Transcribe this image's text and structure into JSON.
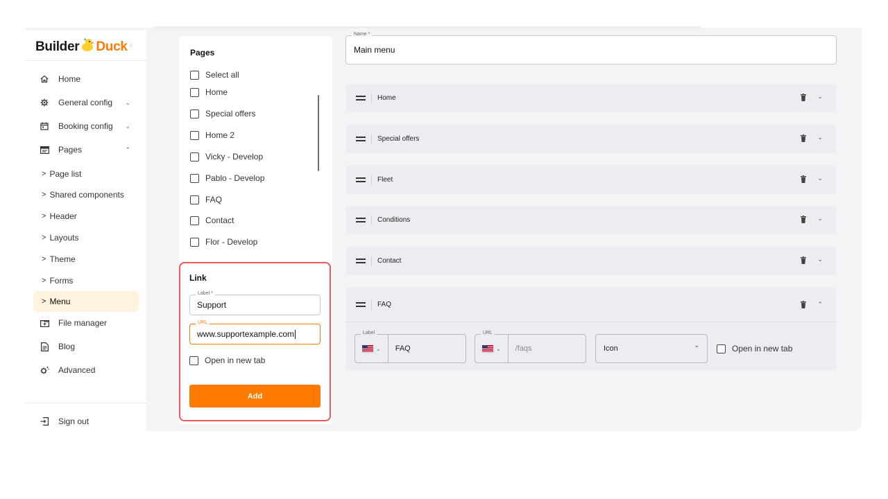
{
  "sidebar": {
    "logo_left": "Builder",
    "logo_right": "Duck",
    "collapse_glyph": "‹",
    "nav": [
      {
        "label": "Home",
        "icon": "home-icon"
      },
      {
        "label": "General config",
        "icon": "gear-icon",
        "chevron": "⌄"
      },
      {
        "label": "Booking config",
        "icon": "calendar-icon",
        "chevron": "⌄"
      },
      {
        "label": "Pages",
        "icon": "browser-icon",
        "chevron": "⌃"
      }
    ],
    "sub": [
      {
        "label": "Page list"
      },
      {
        "label": "Shared components"
      },
      {
        "label": "Header"
      },
      {
        "label": "Layouts"
      },
      {
        "label": "Theme"
      },
      {
        "label": "Forms"
      },
      {
        "label": "Menu",
        "active": true
      }
    ],
    "nav2": [
      {
        "label": "File manager",
        "icon": "file-manager-icon"
      },
      {
        "label": "Blog",
        "icon": "blog-icon"
      },
      {
        "label": "Advanced",
        "icon": "advanced-gear-icon"
      }
    ],
    "sign_out": "Sign out",
    "sub_prefix": ">"
  },
  "pages_panel": {
    "title": "Pages",
    "items": [
      "Select all",
      "Home",
      "Special offers",
      "Home 2",
      "Vicky - Develop",
      "Pablo - Develop",
      "FAQ",
      "Contact",
      "Flor - Develop"
    ]
  },
  "link": {
    "title": "Link",
    "label_label": "Label *",
    "label_value": "Support",
    "url_label": "URL",
    "url_value": "www.supportexample.com",
    "open_new_tab": "Open in new tab",
    "add_button": "Add"
  },
  "menu": {
    "name_label": "Name *",
    "name_value": "Main menu",
    "items": [
      "Home",
      "Special offers",
      "Fleet",
      "Conditions",
      "Contact",
      "FAQ"
    ],
    "collapsed_chevron": "⌄",
    "expanded_chevron": "⌃",
    "faq_edit": {
      "label_label": "Label",
      "label_value": "FAQ",
      "url_label": "URL",
      "url_placeholder": "/faqs",
      "icon_select": "Icon",
      "select_chevron": "⌄",
      "flag_drop": "⌄",
      "open_new_tab": "Open in new tab"
    }
  },
  "colors": {
    "accent": "#ff7a00",
    "highlight_border": "#ee5a5a",
    "active_nav_bg": "#fff3df"
  }
}
